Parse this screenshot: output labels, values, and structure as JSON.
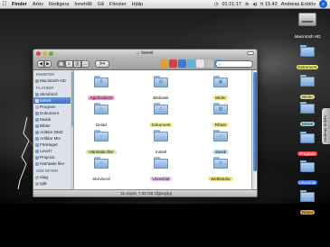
{
  "menubar": {
    "app_name": "Finder",
    "menus": [
      "Arkiv",
      "Redigera",
      "Innehåll",
      "Gå",
      "Fönster",
      "Hjälp"
    ],
    "clock_time": "01:21:17",
    "date_time": "fr 15.42",
    "user": "Andreas Ecklöv"
  },
  "window": {
    "title": "loevet",
    "search_placeholder": "",
    "status": "15 objekt, 7,59 GB tillgängligt"
  },
  "sidebar": {
    "sections": [
      {
        "header": "ENHETER",
        "items": [
          {
            "label": "Macintosh HD",
            "color": "#9a9a9a"
          }
        ]
      },
      {
        "header": "PLATSER",
        "items": [
          {
            "label": "Skrivbord",
            "color": "#7fa0c8"
          },
          {
            "label": "loevet",
            "color": "#8fb0d8",
            "selected": true
          },
          {
            "label": "Program",
            "color": "#c4a6d8"
          },
          {
            "label": "Dokument",
            "color": "#7fa0c8"
          },
          {
            "label": "Musik",
            "color": "#7fa0c8"
          },
          {
            "label": "Bilder",
            "color": "#7fa0c8"
          },
          {
            "label": "Artiklar DMZ",
            "color": "#7fa0c8"
          },
          {
            "label": "Artiklar MH",
            "color": "#7fa0c8"
          },
          {
            "label": "Företaget",
            "color": "#7fa0c8"
          },
          {
            "label": "Level7",
            "color": "#7fa0c8"
          },
          {
            "label": "Projects",
            "color": "#7fa0c8"
          },
          {
            "label": "Hämtade filer",
            "color": "#7fa0c8"
          }
        ]
      },
      {
        "header": "SÖK EFTER",
        "items": [
          {
            "label": "Idag",
            "color": "#a9a9a9"
          },
          {
            "label": "Igår",
            "color": "#a9a9a9"
          }
        ]
      }
    ]
  },
  "files": [
    {
      "label": "Applications",
      "tag": "#f0a0c0",
      "glyph": "A"
    },
    {
      "label": "Bibliotek",
      "tag": "",
      "glyph": "▤"
    },
    {
      "label": "Bilder",
      "tag": "#f2ee9a",
      "glyph": "▣"
    },
    {
      "label": "Delad",
      "tag": "",
      "glyph": "◇"
    },
    {
      "label": "Dokument",
      "tag": "#f2ee9a",
      "glyph": "≡"
    },
    {
      "label": "Filmer",
      "tag": "#f2e08a",
      "glyph": "▦"
    },
    {
      "label": "Hämtade filer",
      "tag": "#d8e6b0",
      "glyph": "↓"
    },
    {
      "label": "Install",
      "tag": "",
      "glyph": ""
    },
    {
      "label": "Musik",
      "tag": "#bde4ec",
      "glyph": "♪"
    },
    {
      "label": "Skrivbord",
      "tag": "",
      "glyph": "▭"
    },
    {
      "label": "Utvecklat",
      "tag": "#e2c4ec",
      "glyph": ""
    },
    {
      "label": "Webbsidor",
      "tag": "#f2e08a",
      "glyph": "◎"
    }
  ],
  "desktop": {
    "drive": {
      "label": "Macintosh HD"
    },
    "folders": [
      {
        "label": "Dokument",
        "tag": "#e7e27a"
      },
      {
        "label": "Bilder",
        "tag": "#e7e27a"
      },
      {
        "label": "Musik",
        "tag": "#8fd8e6"
      },
      {
        "label": "Program",
        "tag": "#e64848"
      },
      {
        "label": "Utvecklat",
        "tag": "#3f6fd8"
      },
      {
        "label": "Filmer",
        "tag": "#e6a23c"
      }
    ]
  },
  "side_tab": {
    "label": "Andreas Ecklöv"
  }
}
